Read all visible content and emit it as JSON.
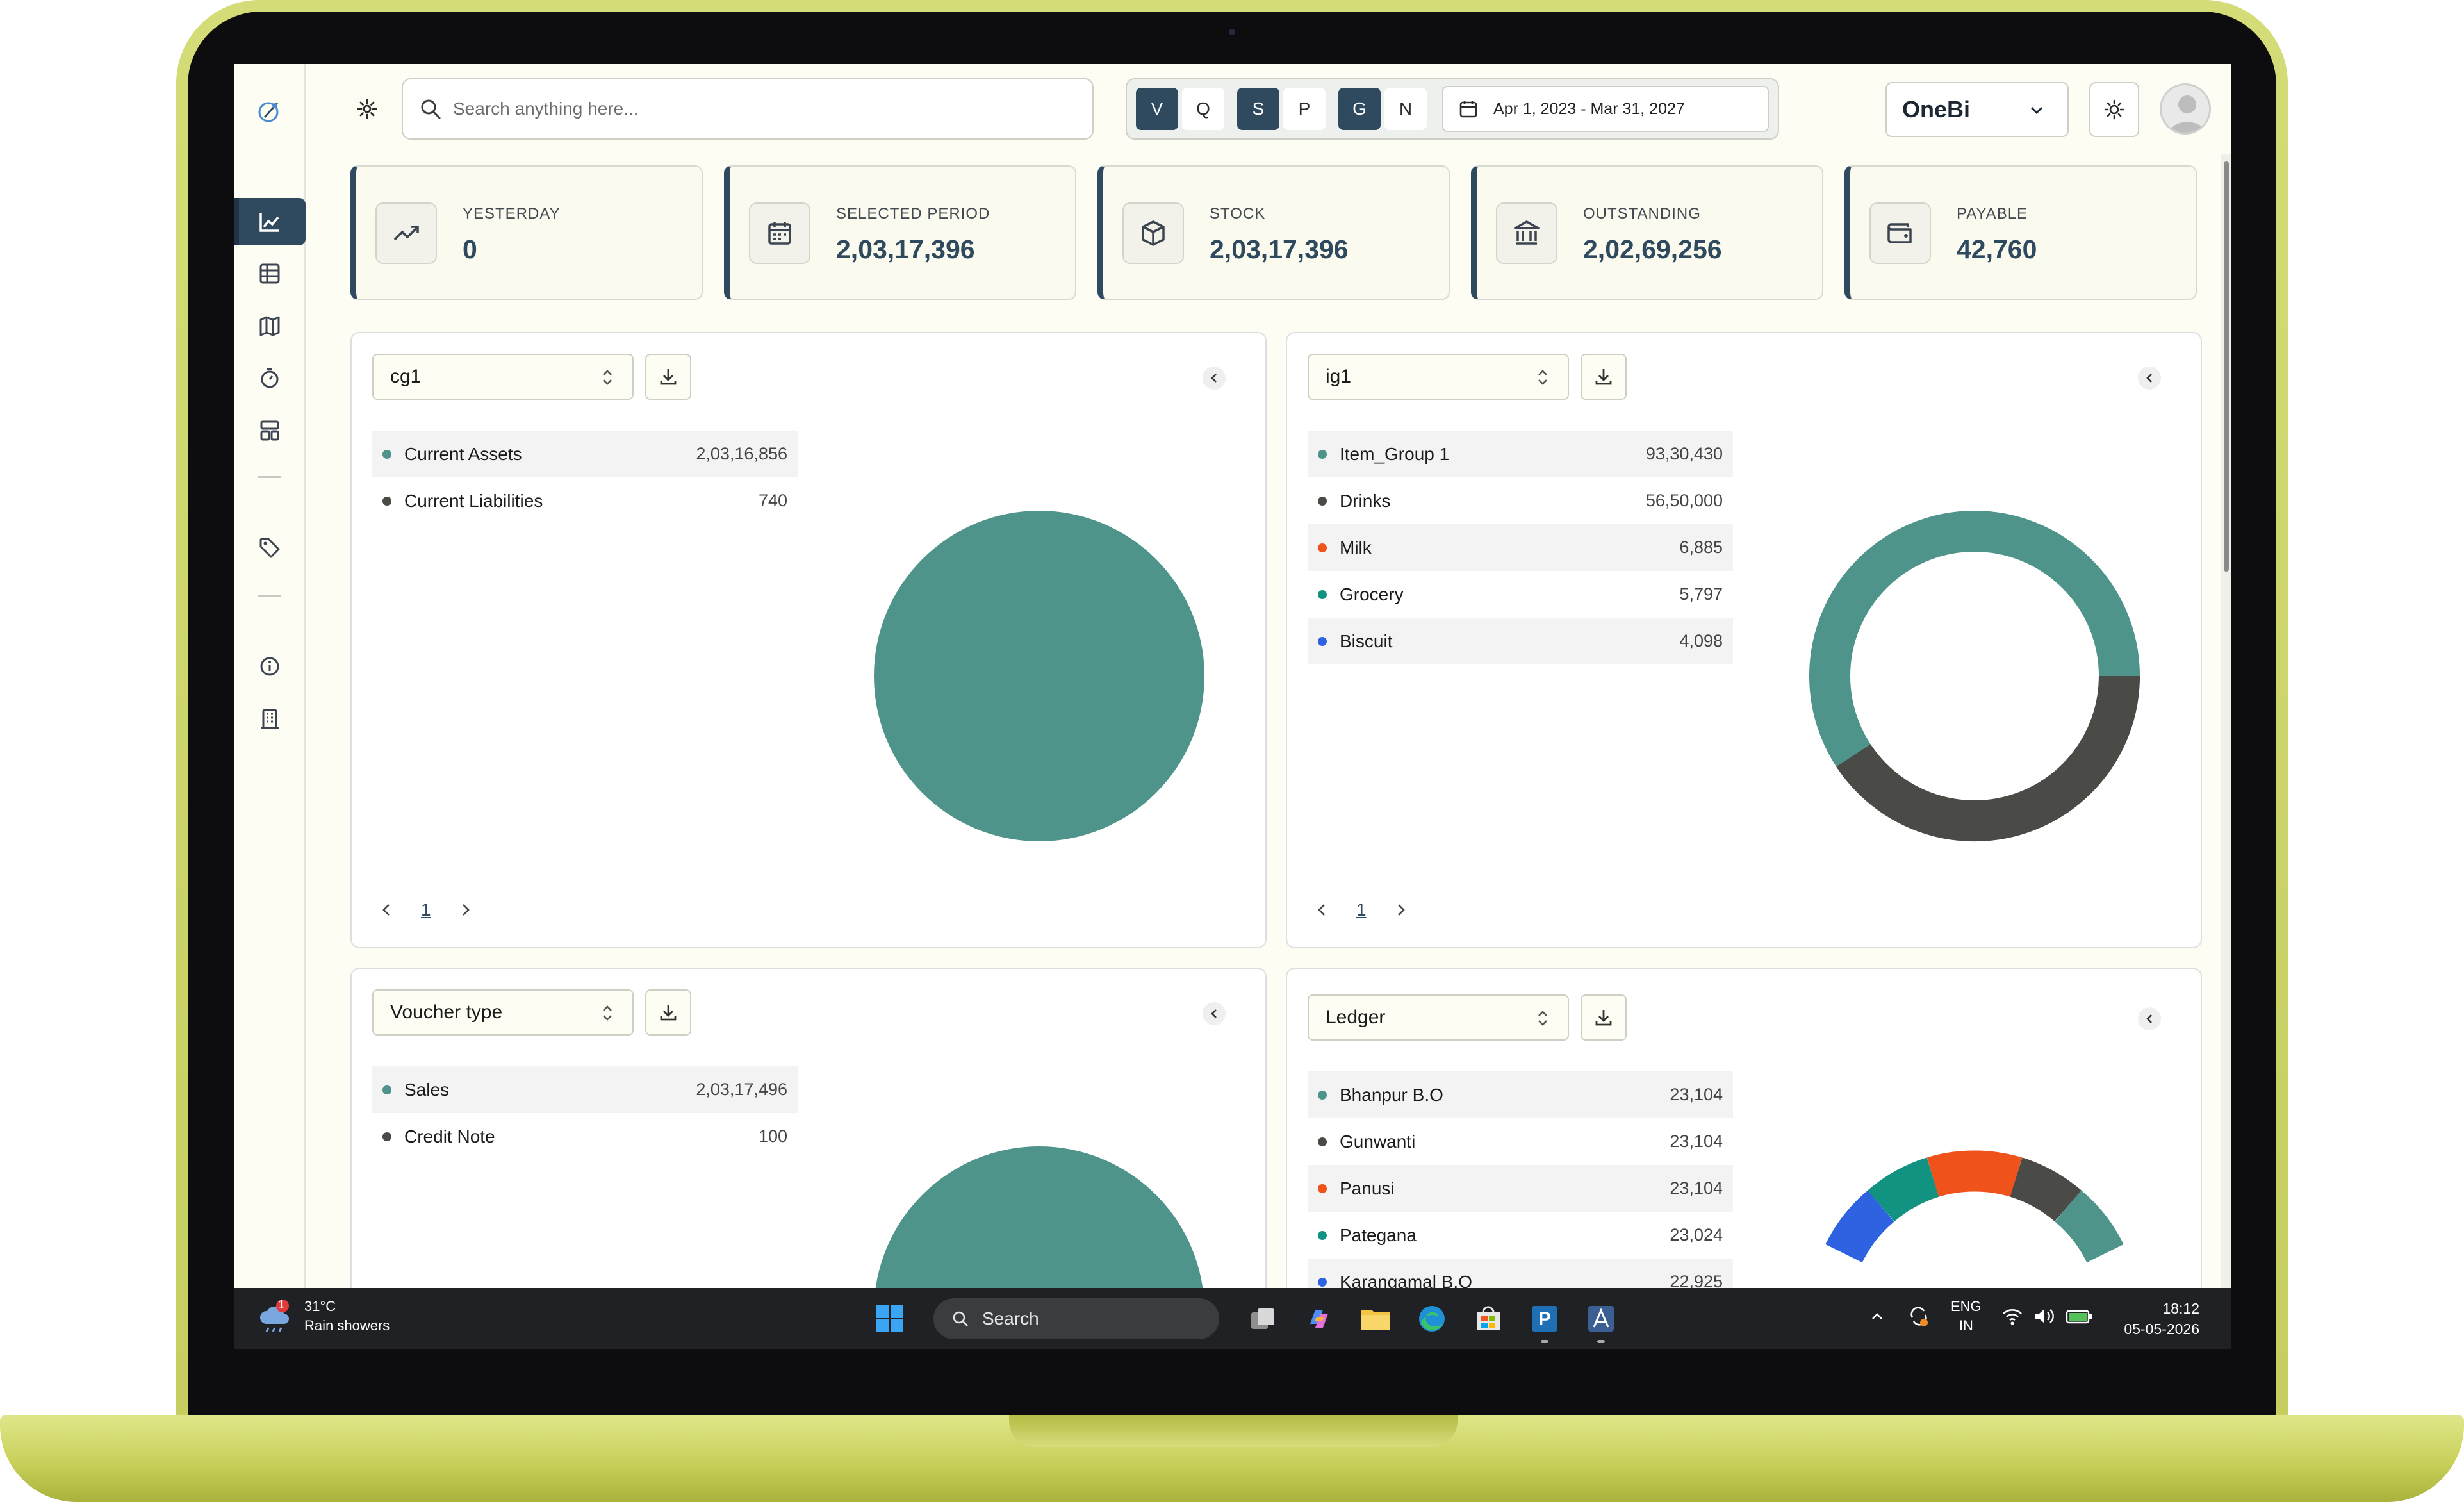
{
  "topbar": {
    "search_placeholder": "Search anything here...",
    "filters": [
      {
        "label": "V",
        "active": true
      },
      {
        "label": "Q",
        "active": false
      },
      {
        "label": "S",
        "active": true
      },
      {
        "label": "P",
        "active": false
      },
      {
        "label": "G",
        "active": true
      },
      {
        "label": "N",
        "active": false
      }
    ],
    "date_range": "Apr 1, 2023 - Mar 31, 2027",
    "company": "OneBi"
  },
  "sidebar": {
    "items": [
      "chart-icon",
      "table-icon",
      "map-icon",
      "timer-icon",
      "layout-icon",
      "tag-icon",
      "info-icon",
      "building-icon"
    ],
    "active": "chart-icon"
  },
  "kpis": [
    {
      "label": "YESTERDAY",
      "value": "0",
      "icon": "trend-up-icon"
    },
    {
      "label": "SELECTED PERIOD",
      "value": "2,03,17,396",
      "icon": "calendar-icon"
    },
    {
      "label": "STOCK",
      "value": "2,03,17,396",
      "icon": "box-icon"
    },
    {
      "label": "OUTSTANDING",
      "value": "2,02,69,256",
      "icon": "bank-icon"
    },
    {
      "label": "PAYABLE",
      "value": "42,760",
      "icon": "wallet-icon"
    }
  ],
  "panels": {
    "p1": {
      "select": "cg1",
      "page": "1",
      "rows": [
        {
          "name": "Current Assets",
          "value": "2,03,16,856",
          "color": "#4e948a"
        },
        {
          "name": "Current Liabilities",
          "value": "740",
          "color": "#4a4a46"
        }
      ]
    },
    "p2": {
      "select": "ig1",
      "page": "1",
      "rows": [
        {
          "name": "Item_Group 1",
          "value": "93,30,430",
          "color": "#4e948a"
        },
        {
          "name": "Drinks",
          "value": "56,50,000",
          "color": "#4a4a46"
        },
        {
          "name": "Milk",
          "value": "6,885",
          "color": "#f0521c"
        },
        {
          "name": "Grocery",
          "value": "5,797",
          "color": "#129281"
        },
        {
          "name": "Biscuit",
          "value": "4,098",
          "color": "#2f62e0"
        }
      ]
    },
    "p3": {
      "select": "Voucher type",
      "rows": [
        {
          "name": "Sales",
          "value": "2,03,17,496",
          "color": "#4e948a"
        },
        {
          "name": "Credit Note",
          "value": "100",
          "color": "#4a4a46"
        }
      ]
    },
    "p4": {
      "select": "Ledger",
      "rows": [
        {
          "name": "Bhanpur B.O",
          "value": "23,104",
          "color": "#4e948a"
        },
        {
          "name": "Gunwanti",
          "value": "23,104",
          "color": "#4a4a46"
        },
        {
          "name": "Panusi",
          "value": "23,104",
          "color": "#f0521c"
        },
        {
          "name": "Pategana",
          "value": "23,024",
          "color": "#129281"
        },
        {
          "name": "Karangamal B.O",
          "value": "22,925",
          "color": "#2f62e0"
        }
      ]
    }
  },
  "taskbar": {
    "temp": "31°C",
    "weather": "Rain showers",
    "weather_badge": "1",
    "search": "Search",
    "lang_top": "ENG",
    "lang_bottom": "IN",
    "time": "18:12",
    "date": "05-05-2026"
  }
}
